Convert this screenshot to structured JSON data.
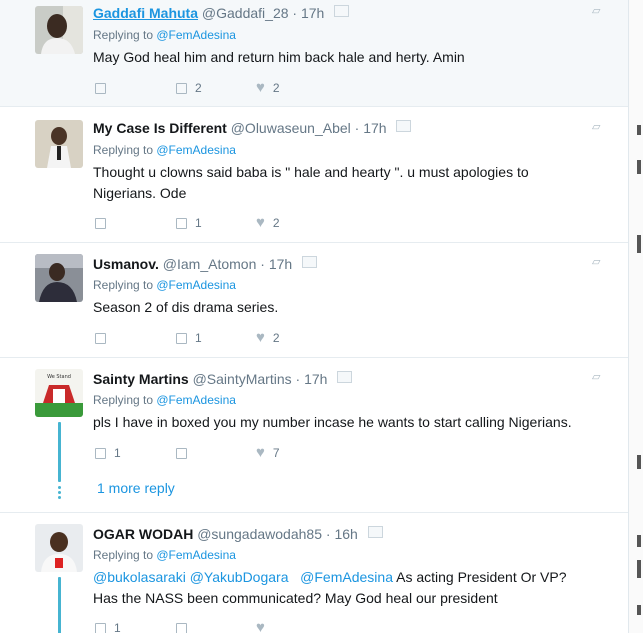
{
  "tweets": [
    {
      "fullname": "Gaddafi Mahuta",
      "handle": "@Gaddafi_28",
      "dot": "·",
      "time": "17h",
      "replying_prefix": "Replying to ",
      "replying_to": "@FemAdesina",
      "text": "May God heal him and return him back hale and herty. Amin",
      "replies": "",
      "retweets": "2",
      "likes": "2"
    },
    {
      "fullname": "My Case Is Different",
      "handle": "@Oluwaseun_Abel",
      "dot": "·",
      "time": "17h",
      "replying_prefix": "Replying to ",
      "replying_to": "@FemAdesina",
      "text_line1": "Thought u clowns said baba is \" hale and hearty \". u must apologies to",
      "text_line2": "Nigerians. Ode",
      "replies": "",
      "retweets": "1",
      "likes": "2"
    },
    {
      "fullname": "Usmanov.",
      "handle": "@Iam_Atomon",
      "dot": "·",
      "time": "17h",
      "replying_prefix": "Replying to ",
      "replying_to": "@FemAdesina",
      "text": "Season 2 of dis drama series.",
      "replies": "",
      "retweets": "1",
      "likes": "2"
    },
    {
      "fullname": "Sainty Martins",
      "handle": "@SaintyMartins",
      "dot": "·",
      "time": "17h",
      "replying_prefix": "Replying to ",
      "replying_to": "@FemAdesina",
      "text": "pls I have in boxed you my number incase he wants to start  calling Nigerians.",
      "replies": "1",
      "retweets": "",
      "likes": "7",
      "more_replies": "1 more reply"
    },
    {
      "fullname": "OGAR WODAH",
      "handle": "@sungadawodah85",
      "dot": "·",
      "time": "16h",
      "replying_prefix": "Replying to ",
      "replying_to": "@FemAdesina",
      "mention1": "@bukolasaraki",
      "mention2": "@YakubDogara",
      "mention3": "@FemAdesina",
      "text_after": " As acting President Or VP?",
      "text_line2": "Has the NASS been communicated? May God heal our president",
      "replies": "1",
      "retweets": "",
      "likes": ""
    }
  ],
  "colors": {
    "link": "#1b95e0",
    "muted": "#657786",
    "thread": "#46b4d1",
    "highlight_bg": "#f5f8fa"
  },
  "icons": [
    "reply-icon",
    "retweet-icon",
    "heart-icon",
    "caret-down-icon",
    "verified-icon"
  ]
}
